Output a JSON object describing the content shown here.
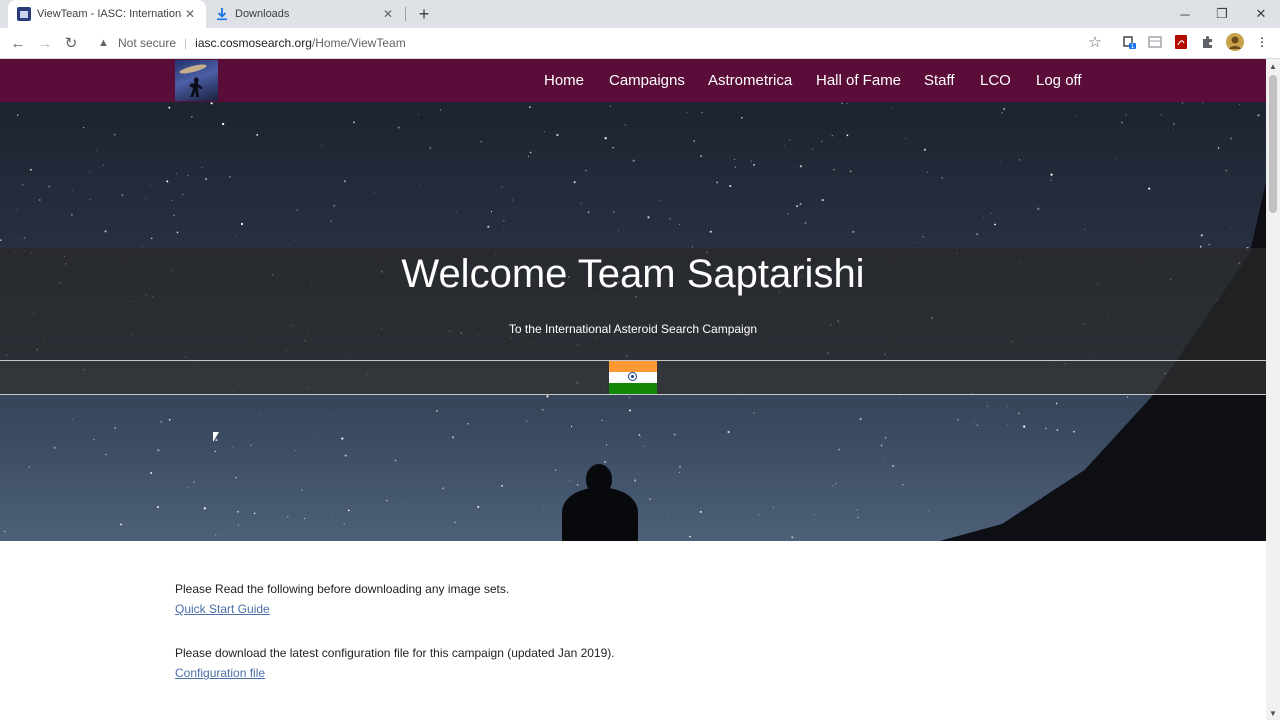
{
  "browser": {
    "tabs": [
      {
        "title": "ViewTeam - IASC: International A",
        "active": true,
        "favicon": "site-favicon"
      },
      {
        "title": "Downloads",
        "active": false,
        "favicon": "download-icon"
      }
    ],
    "new_tab_symbol": "+",
    "window_controls": {
      "minimize": "─",
      "maximize": "❐",
      "close": "✕"
    },
    "address": {
      "security_label": "Not secure",
      "host": "iasc.cosmosearch.org",
      "path": "/Home/ViewTeam"
    },
    "extension_badge": "1"
  },
  "site": {
    "nav": [
      "Home",
      "Campaigns",
      "Astrometrica",
      "Hall of Fame",
      "Staff",
      "LCO",
      "Log off"
    ]
  },
  "hero": {
    "title": "Welcome Team Saptarishi",
    "subtitle": "To the International Asteroid Search Campaign",
    "flag": {
      "name": "India",
      "colors": [
        "#ff9933",
        "#ffffff",
        "#138808"
      ],
      "chakra": "#1a3c8f"
    }
  },
  "content": {
    "read_text": "Please Read the following before downloading any image sets.",
    "guide_link": "Quick Start Guide",
    "config_text": "Please download the latest configuration file for this campaign (updated Jan 2019).",
    "config_link": "Configuration file"
  },
  "colors": {
    "nav_bg": "#5b0d3a",
    "link": "#4b6fa6"
  }
}
